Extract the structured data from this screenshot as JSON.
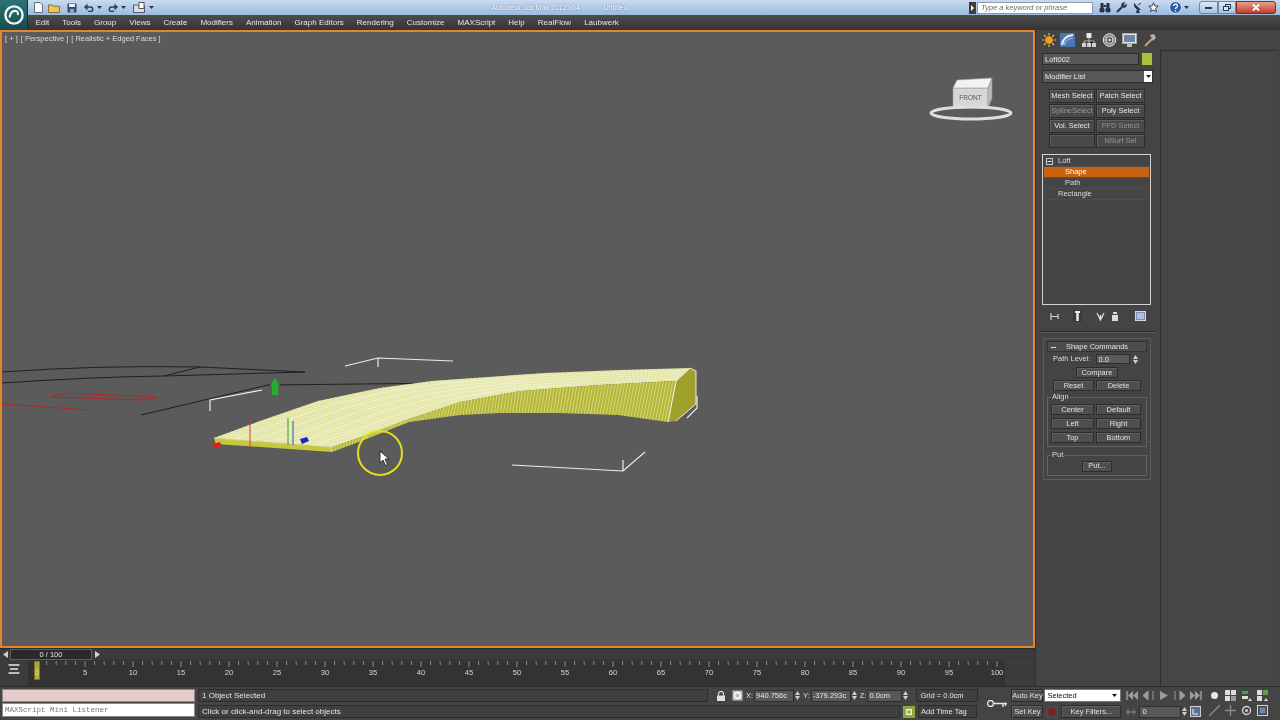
{
  "title_bar": {
    "title": "Autodesk 3ds Max 2012 x64",
    "document": "Untitled",
    "search": {
      "placeholder": "Type a keyword or phrase"
    }
  },
  "menu_bar": [
    "Edit",
    "Tools",
    "Group",
    "Views",
    "Create",
    "Modifiers",
    "Animation",
    "Graph Editors",
    "Rendering",
    "Customize",
    "MAXScript",
    "Help",
    "RealFlow",
    "Laubwerk"
  ],
  "viewport": {
    "labels": [
      "[ + ]",
      "[ Perspective ]",
      "[ Realistic + Edged Faces ]"
    ],
    "view_cube": "FRONT"
  },
  "command_panel": {
    "object_name": "Loft002",
    "modifier_list": "Modifier List",
    "modifier_buttons": [
      {
        "kind": "button",
        "label": "Mesh Select",
        "disabled": false
      },
      {
        "kind": "button",
        "label": "Patch Select",
        "disabled": false
      },
      {
        "kind": "button",
        "label": "SplineSelect",
        "disabled": true
      },
      {
        "kind": "button",
        "label": "Poly Select",
        "disabled": false
      },
      {
        "kind": "button",
        "label": "Vol. Select",
        "disabled": false
      },
      {
        "kind": "button",
        "label": "FFD Select",
        "disabled": true
      },
      {
        "kind": "empty"
      },
      {
        "kind": "button",
        "label": "NSurf Sel",
        "disabled": true
      }
    ],
    "stack": [
      {
        "label": "Loft",
        "expanded": true,
        "selected": false,
        "children": [
          {
            "label": "Shape",
            "selected": true
          },
          {
            "label": "Path",
            "selected": false
          }
        ]
      },
      {
        "label": "Rectangle",
        "selected": false
      }
    ],
    "rollout": {
      "title": "Shape Commands",
      "expanded": true,
      "path_level": {
        "label": "Path Level:",
        "value": "0.0"
      },
      "compare": "Compare",
      "actions": [
        "Reset",
        "Delete"
      ],
      "align": {
        "title": "Align",
        "buttons": [
          "Center",
          "Default",
          "Left",
          "Right",
          "Top",
          "Bottom"
        ]
      },
      "put": {
        "title": "Put",
        "button": "Put..."
      }
    }
  },
  "timeline": {
    "frame": "0 / 100",
    "level": 0,
    "ticks": [
      "0",
      "5",
      "10",
      "15",
      "20",
      "25",
      "30",
      "35",
      "40",
      "45",
      "50",
      "55",
      "60",
      "65",
      "70",
      "75",
      "80",
      "85",
      "90",
      "95",
      "100"
    ]
  },
  "mini_listener": {
    "placeholder": "MAXScript Mini Listener"
  },
  "status_bar": {
    "selection": "1 Object Selected",
    "prompt": "Click or click-and-drag to select objects",
    "coordinates": [
      {
        "axis": "X:",
        "value": "940.756c"
      },
      {
        "axis": "Y:",
        "value": "-379.293c"
      },
      {
        "axis": "Z:",
        "value": "0.0cm"
      }
    ],
    "grid": "Grid = 0.0cm",
    "time_tag": "Add Time Tag"
  },
  "animation_controls": {
    "auto_key": {
      "label": "Auto Key",
      "on": false
    },
    "key_mode": "Selected",
    "set_key": "Set Key",
    "key_filters": "Key Filters...",
    "frame": "0"
  }
}
